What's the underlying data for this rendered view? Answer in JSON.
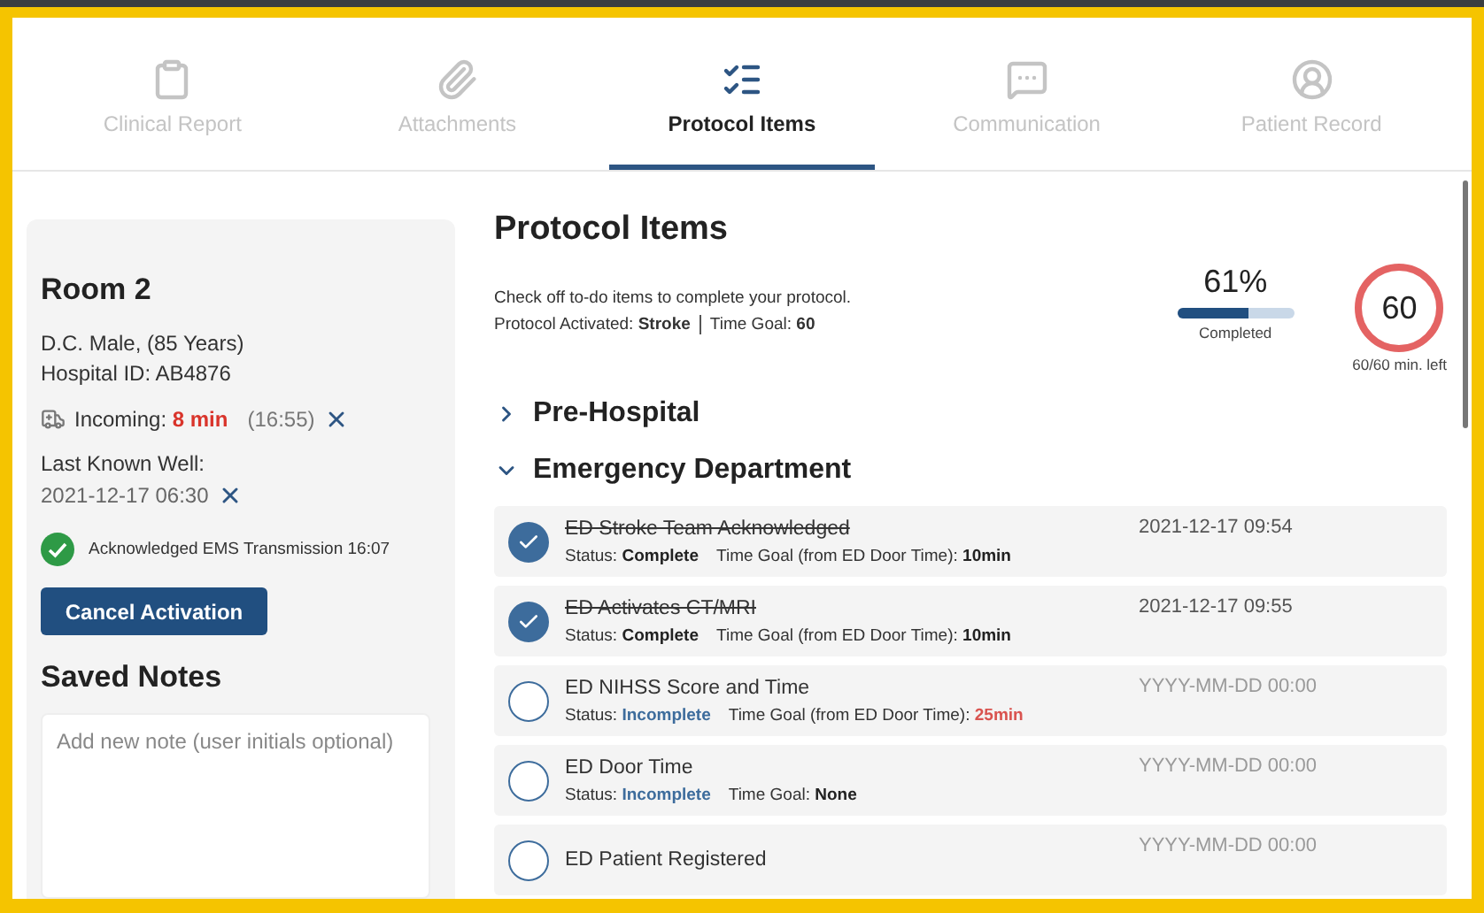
{
  "tabs": [
    {
      "label": "Clinical Report",
      "selected": false
    },
    {
      "label": "Attachments",
      "selected": false
    },
    {
      "label": "Protocol Items",
      "selected": true
    },
    {
      "label": "Communication",
      "selected": false
    },
    {
      "label": "Patient Record",
      "selected": false
    }
  ],
  "patient": {
    "room": "Room 2",
    "line_1": "D.C. Male, (85 Years)",
    "line_2": "Hospital ID: AB4876",
    "incoming_label": "Incoming:",
    "incoming_eta": "8 min",
    "incoming_time": "(16:55)",
    "lkw_label": "Last Known Well:",
    "lkw_value": "2021-12-17 06:30",
    "acknowledged": "Acknowledged EMS Transmission 16:07",
    "cancel_button": "Cancel Activation"
  },
  "notes": {
    "title": "Saved Notes",
    "placeholder": "Add new note (user initials optional)"
  },
  "protocol": {
    "title": "Protocol Items",
    "intro": "Check off to-do items to complete your protocol.",
    "activated_label": "Protocol Activated:",
    "activated_value": "Stroke",
    "goal_label": "Time Goal:",
    "goal_value": "60",
    "percent": "61%",
    "level": 0.61,
    "completed_label": "Completed",
    "timer": "60",
    "timer_caption": "60/60 min. left"
  },
  "sections": [
    {
      "title": "Pre-Hospital",
      "expanded": false
    },
    {
      "title": "Emergency Department",
      "expanded": true
    }
  ],
  "items": [
    {
      "title": "ED Stroke Team Acknowledged",
      "checked": true,
      "status_label": "Status:",
      "status": "Complete",
      "goal_label": "Time Goal (from ED Door Time):",
      "goal": "10min",
      "goal_late": false,
      "date": "2021-12-17 09:54"
    },
    {
      "title": "ED Activates CT/MRI",
      "checked": true,
      "status_label": "Status:",
      "status": "Complete",
      "goal_label": "Time Goal (from ED Door Time):",
      "goal": "10min",
      "goal_late": false,
      "date": "2021-12-17 09:55"
    },
    {
      "title": "ED NIHSS Score and Time",
      "checked": false,
      "status_label": "Status:",
      "status": "Incomplete",
      "goal_label": "Time Goal (from ED Door Time):",
      "goal": "25min",
      "goal_late": true,
      "placeholder": "YYYY-MM-DD 00:00"
    },
    {
      "title": "ED Door Time",
      "checked": false,
      "status_label": "Status:",
      "status": "Incomplete",
      "goal_label": "Time Goal:",
      "goal": "None",
      "goal_late": false,
      "placeholder": "YYYY-MM-DD 00:00"
    },
    {
      "title": "ED Patient Registered",
      "checked": false,
      "placeholder": "YYYY-MM-DD 00:00"
    }
  ]
}
